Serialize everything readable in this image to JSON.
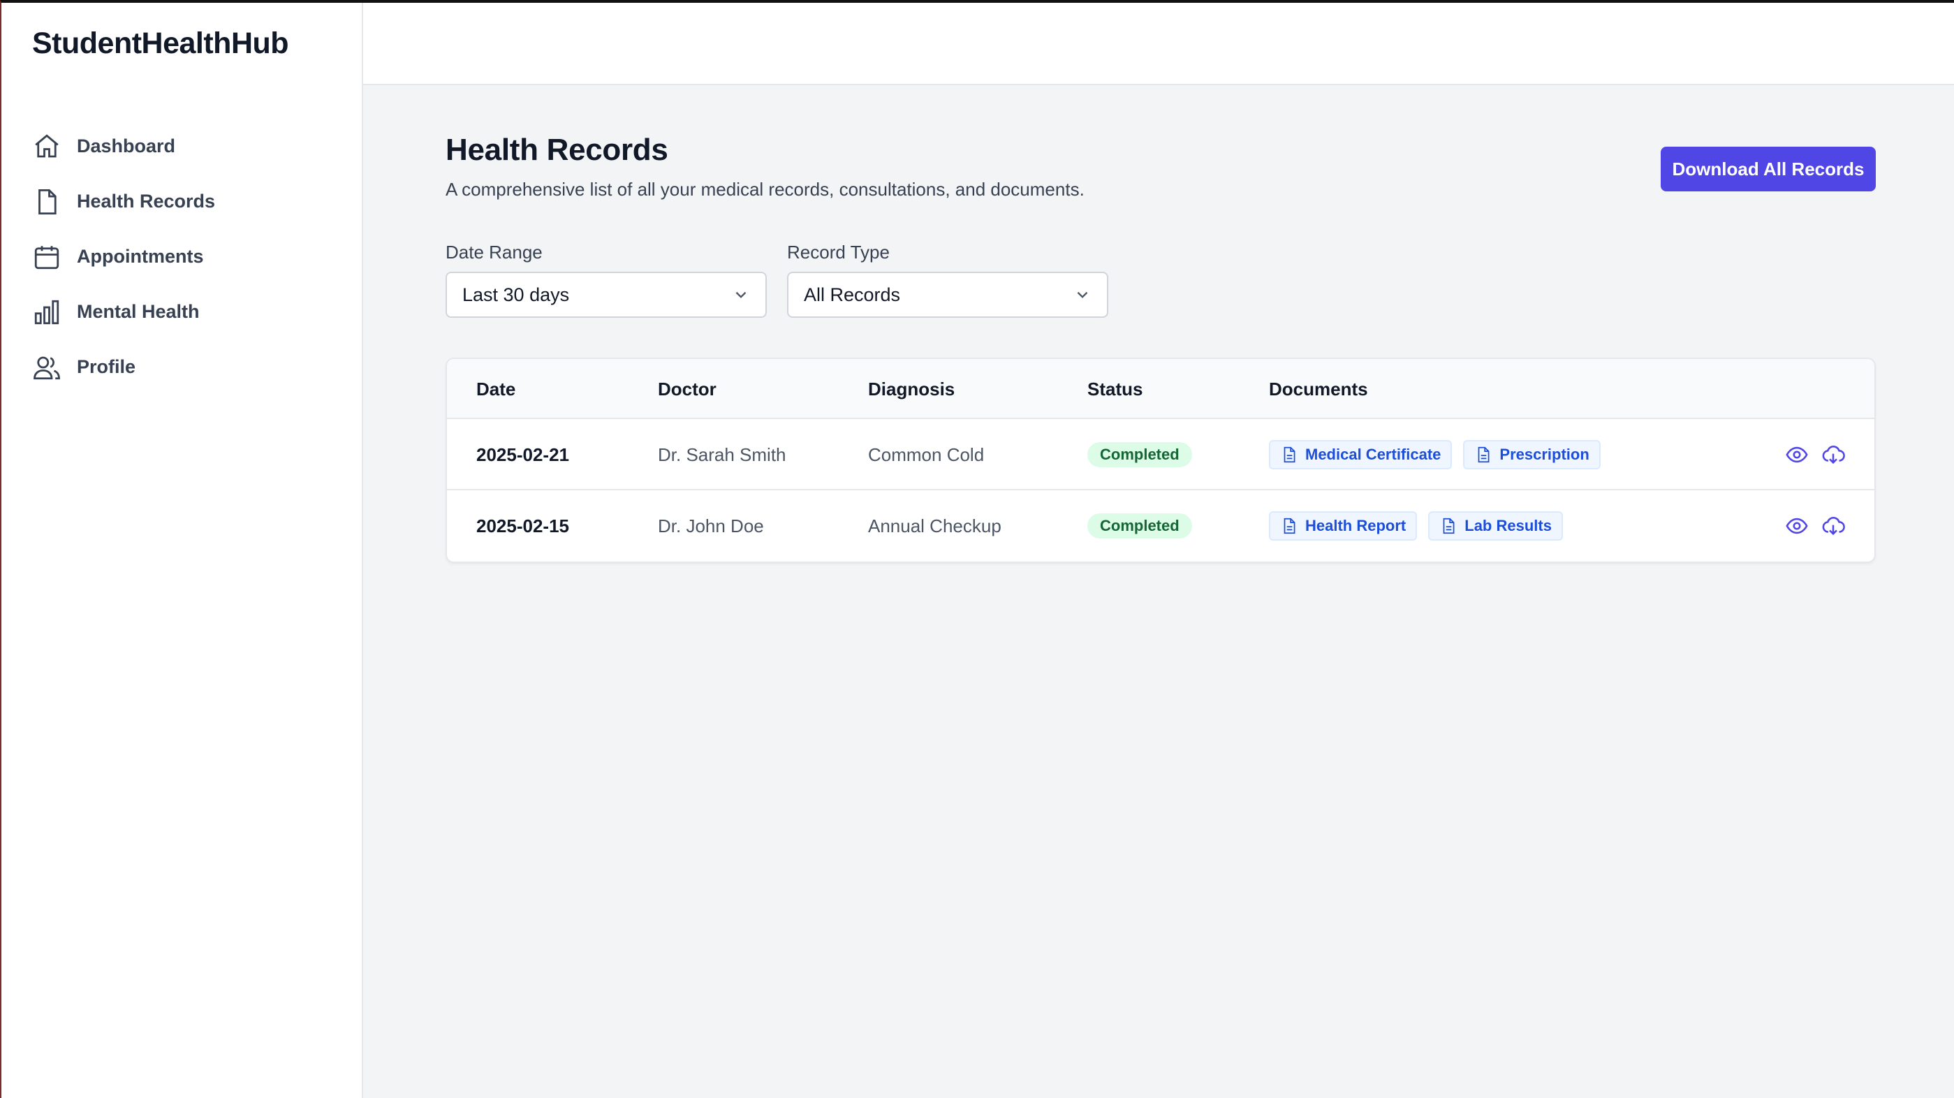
{
  "sidebar": {
    "brand": "StudentHealthHub",
    "items": [
      {
        "label": "Dashboard",
        "icon": "home-icon"
      },
      {
        "label": "Health Records",
        "icon": "document-icon"
      },
      {
        "label": "Appointments",
        "icon": "calendar-icon"
      },
      {
        "label": "Mental Health",
        "icon": "bar-chart-icon"
      },
      {
        "label": "Profile",
        "icon": "users-icon"
      }
    ]
  },
  "main": {
    "title": "Health Records",
    "subtitle": "A comprehensive list of all your medical records, consultations, and documents.",
    "download_all_label": "Download All Records",
    "filters": {
      "date_range": {
        "label": "Date Range",
        "value": "Last 30 days"
      },
      "record_type": {
        "label": "Record Type",
        "value": "All Records"
      }
    },
    "table": {
      "headers": [
        "Date",
        "Doctor",
        "Diagnosis",
        "Status",
        "Documents"
      ],
      "rows": [
        {
          "date": "2025-02-21",
          "doctor": "Dr. Sarah Smith",
          "diagnosis": "Common Cold",
          "status": "Completed",
          "documents": [
            "Medical Certificate",
            "Prescription"
          ]
        },
        {
          "date": "2025-02-15",
          "doctor": "Dr. John Doe",
          "diagnosis": "Annual Checkup",
          "status": "Completed",
          "documents": [
            "Health Report",
            "Lab Results"
          ]
        }
      ]
    }
  },
  "colors": {
    "accent": "#4f46e5",
    "status_completed_bg": "#dcfce7",
    "status_completed_text": "#166534",
    "doc_chip_text": "#1d4ed8"
  }
}
